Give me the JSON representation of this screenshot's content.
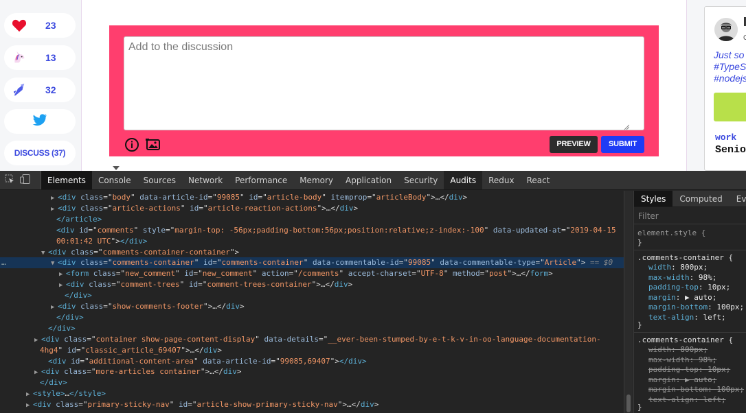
{
  "reactions": [
    {
      "icon": "heart-icon",
      "count": "23"
    },
    {
      "icon": "unicorn-icon",
      "count": "13"
    },
    {
      "icon": "bookmark-icon",
      "count": "32"
    },
    {
      "icon": "twitter-icon",
      "count": ""
    }
  ],
  "discuss_label": "DISCUSS (37)",
  "comment": {
    "placeholder": "Add to the discussion",
    "preview_label": "PREVIEW",
    "submit_label": "SUBMIT"
  },
  "sidecard": {
    "name_fragment": "I",
    "sub_fragment": "G",
    "blurb": "Just so\n#TypeS\n#nodejs",
    "work_label": "work",
    "work_value": "Senio"
  },
  "devtools": {
    "tabs": [
      "Elements",
      "Console",
      "Sources",
      "Network",
      "Performance",
      "Memory",
      "Application",
      "Security",
      "Audits",
      "Redux",
      "React"
    ],
    "active_tab": "Elements",
    "selected_tab": "Audits",
    "dom_lines": [
      {
        "indent": 86,
        "tri": "▶",
        "html": [
          [
            "tg",
            "<div "
          ],
          [
            "an",
            "class"
          ],
          [
            "tx",
            "=\""
          ],
          [
            "av",
            "body"
          ],
          [
            "tx",
            "\" "
          ],
          [
            "an",
            "data-article-id"
          ],
          [
            "tx",
            "=\""
          ],
          [
            "av",
            "99085"
          ],
          [
            "tx",
            "\" "
          ],
          [
            "an",
            "id"
          ],
          [
            "tx",
            "=\""
          ],
          [
            "av",
            "article-body"
          ],
          [
            "tx",
            "\" "
          ],
          [
            "an",
            "itemprop"
          ],
          [
            "tx",
            "=\""
          ],
          [
            "av",
            "articleBody"
          ],
          [
            "tx",
            "\">…</"
          ],
          [
            "tg",
            "div"
          ],
          [
            "tx",
            ">"
          ]
        ]
      },
      {
        "indent": 86,
        "tri": "▶",
        "html": [
          [
            "tg",
            "<div "
          ],
          [
            "an",
            "class"
          ],
          [
            "tx",
            "=\""
          ],
          [
            "av",
            "article-actions"
          ],
          [
            "tx",
            "\" "
          ],
          [
            "an",
            "id"
          ],
          [
            "tx",
            "=\""
          ],
          [
            "av",
            "article-reaction-actions"
          ],
          [
            "tx",
            "\">…</"
          ],
          [
            "tg",
            "div"
          ],
          [
            "tx",
            ">"
          ]
        ]
      },
      {
        "indent": 84,
        "tri": "",
        "html": [
          [
            "tg",
            "</article>"
          ]
        ]
      },
      {
        "indent": 84,
        "tri": "",
        "html": [
          [
            "tg",
            "<div "
          ],
          [
            "an",
            "id"
          ],
          [
            "tx",
            "=\""
          ],
          [
            "av",
            "comments"
          ],
          [
            "tx",
            "\" "
          ],
          [
            "an",
            "style"
          ],
          [
            "tx",
            "=\""
          ],
          [
            "av",
            "margin-top: -56px;padding-bottom:56px;position:relative;z-index:-100"
          ],
          [
            "tx",
            "\" "
          ],
          [
            "an",
            "data-updated-at"
          ],
          [
            "tx",
            "=\""
          ],
          [
            "av",
            "2019-04-15"
          ]
        ]
      },
      {
        "indent": 84,
        "tri": "",
        "html": [
          [
            "av",
            "00:01:42 UTC"
          ],
          [
            "tx",
            "\">"
          ],
          [
            "tg",
            "</div>"
          ]
        ]
      },
      {
        "indent": 72,
        "tri": "▼",
        "html": [
          [
            "tg",
            "<div "
          ],
          [
            "an",
            "class"
          ],
          [
            "tx",
            "=\""
          ],
          [
            "av",
            "comments-container-container"
          ],
          [
            "tx",
            "\">"
          ]
        ]
      },
      {
        "indent": 86,
        "tri": "▼",
        "selected": true,
        "html": [
          [
            "tg",
            "<div "
          ],
          [
            "an",
            "class"
          ],
          [
            "tx",
            "=\""
          ],
          [
            "av",
            "comments-container"
          ],
          [
            "tx",
            "\" "
          ],
          [
            "an",
            "id"
          ],
          [
            "tx",
            "=\""
          ],
          [
            "av",
            "comments-container"
          ],
          [
            "tx",
            "\" "
          ],
          [
            "an",
            "data-commentable-id"
          ],
          [
            "tx",
            "=\""
          ],
          [
            "av",
            "99085"
          ],
          [
            "tx",
            "\" "
          ],
          [
            "an",
            "data-commentable-type"
          ],
          [
            "tx",
            "=\""
          ],
          [
            "av",
            "Article"
          ],
          [
            "tx",
            "\"> "
          ],
          [
            "eq0",
            "== $0"
          ]
        ]
      },
      {
        "indent": 98,
        "tri": "▶",
        "html": [
          [
            "tg",
            "<form "
          ],
          [
            "an",
            "class"
          ],
          [
            "tx",
            "=\""
          ],
          [
            "av",
            "new_comment"
          ],
          [
            "tx",
            "\" "
          ],
          [
            "an",
            "id"
          ],
          [
            "tx",
            "=\""
          ],
          [
            "av",
            "new_comment"
          ],
          [
            "tx",
            "\" "
          ],
          [
            "an",
            "action"
          ],
          [
            "tx",
            "=\""
          ],
          [
            "av",
            "/comments"
          ],
          [
            "tx",
            "\" "
          ],
          [
            "an",
            "accept-charset"
          ],
          [
            "tx",
            "=\""
          ],
          [
            "av",
            "UTF-8"
          ],
          [
            "tx",
            "\" "
          ],
          [
            "an",
            "method"
          ],
          [
            "tx",
            "=\""
          ],
          [
            "av",
            "post"
          ],
          [
            "tx",
            "\">…</"
          ],
          [
            "tg",
            "form"
          ],
          [
            "tx",
            ">"
          ]
        ]
      },
      {
        "indent": 98,
        "tri": "▶",
        "html": [
          [
            "tg",
            "<div "
          ],
          [
            "an",
            "class"
          ],
          [
            "tx",
            "=\""
          ],
          [
            "av",
            "comment-trees"
          ],
          [
            "tx",
            "\" "
          ],
          [
            "an",
            "id"
          ],
          [
            "tx",
            "=\""
          ],
          [
            "av",
            "comment-trees-container"
          ],
          [
            "tx",
            "\">…</"
          ],
          [
            "tg",
            "div"
          ],
          [
            "tx",
            ">"
          ]
        ]
      },
      {
        "indent": 96,
        "tri": "",
        "html": [
          [
            "tg",
            "</div>"
          ]
        ]
      },
      {
        "indent": 86,
        "tri": "▶",
        "html": [
          [
            "tg",
            "<div "
          ],
          [
            "an",
            "class"
          ],
          [
            "tx",
            "=\""
          ],
          [
            "av",
            "show-comments-footer"
          ],
          [
            "tx",
            "\">…</"
          ],
          [
            "tg",
            "div"
          ],
          [
            "tx",
            ">"
          ]
        ]
      },
      {
        "indent": 84,
        "tri": "",
        "html": [
          [
            "tg",
            "</div>"
          ]
        ]
      },
      {
        "indent": 72,
        "tri": "",
        "html": [
          [
            "tg",
            "</div>"
          ]
        ]
      },
      {
        "indent": 62,
        "tri": "▶",
        "html": [
          [
            "tg",
            "<div "
          ],
          [
            "an",
            "class"
          ],
          [
            "tx",
            "=\""
          ],
          [
            "av",
            "container show-page-content-display"
          ],
          [
            "tx",
            "\" "
          ],
          [
            "an",
            "data-details"
          ],
          [
            "tx",
            "=\""
          ],
          [
            "av",
            "__ever-been-stumped-by-e-t-k-v-in-oo-language-documentation-"
          ]
        ]
      },
      {
        "indent": 60,
        "tri": "",
        "html": [
          [
            "av",
            "4hg4"
          ],
          [
            "tx",
            "\" "
          ],
          [
            "an",
            "id"
          ],
          [
            "tx",
            "=\""
          ],
          [
            "av",
            "classic_article_69407"
          ],
          [
            "tx",
            "\">…</"
          ],
          [
            "tg",
            "div"
          ],
          [
            "tx",
            ">"
          ]
        ]
      },
      {
        "indent": 72,
        "tri": "",
        "html": [
          [
            "tg",
            "<div "
          ],
          [
            "an",
            "id"
          ],
          [
            "tx",
            "=\""
          ],
          [
            "av",
            "additional-content-area"
          ],
          [
            "tx",
            "\" "
          ],
          [
            "an",
            "data-article-id"
          ],
          [
            "tx",
            "=\""
          ],
          [
            "av",
            "99085,69407"
          ],
          [
            "tx",
            "\">"
          ],
          [
            "tg",
            "</div>"
          ]
        ]
      },
      {
        "indent": 62,
        "tri": "▶",
        "html": [
          [
            "tg",
            "<div "
          ],
          [
            "an",
            "class"
          ],
          [
            "tx",
            "=\""
          ],
          [
            "av",
            "more-articles container"
          ],
          [
            "tx",
            "\">…</"
          ],
          [
            "tg",
            "div"
          ],
          [
            "tx",
            ">"
          ]
        ]
      },
      {
        "indent": 60,
        "tri": "",
        "html": [
          [
            "tg",
            "</div>"
          ]
        ]
      },
      {
        "indent": 50,
        "tri": "▶",
        "html": [
          [
            "tg",
            "<style>"
          ],
          [
            "tx",
            "…"
          ],
          [
            "tg",
            "</style>"
          ]
        ]
      },
      {
        "indent": 50,
        "tri": "▶",
        "html": [
          [
            "tg",
            "<div "
          ],
          [
            "an",
            "class"
          ],
          [
            "tx",
            "=\""
          ],
          [
            "av",
            "primary-sticky-nav"
          ],
          [
            "tx",
            "\" "
          ],
          [
            "an",
            "id"
          ],
          [
            "tx",
            "=\""
          ],
          [
            "av",
            "article-show-primary-sticky-nav"
          ],
          [
            "tx",
            "\">…</"
          ],
          [
            "tg",
            "div"
          ],
          [
            "tx",
            ">"
          ]
        ]
      }
    ],
    "styles": {
      "tabs": [
        "Styles",
        "Computed",
        "Even"
      ],
      "filter_placeholder": "Filter",
      "element_style": "element.style {",
      "rule1_selector": ".comments-container {",
      "rule1_props": [
        [
          "width",
          "800px"
        ],
        [
          "max-width",
          "98%"
        ],
        [
          "padding-top",
          "10px"
        ],
        [
          "margin",
          "▶ auto"
        ],
        [
          "margin-bottom",
          "100px"
        ],
        [
          "text-align",
          "left"
        ]
      ],
      "rule2_selector": ".comments-container {",
      "rule2_props": [
        [
          "width",
          "800px"
        ],
        [
          "max-width",
          "98%"
        ],
        [
          "padding-top",
          "10px"
        ],
        [
          "margin",
          "▶ auto"
        ],
        [
          "margin-bottom",
          "100px"
        ],
        [
          "text-align",
          "left"
        ]
      ],
      "close_brace": "}"
    }
  }
}
